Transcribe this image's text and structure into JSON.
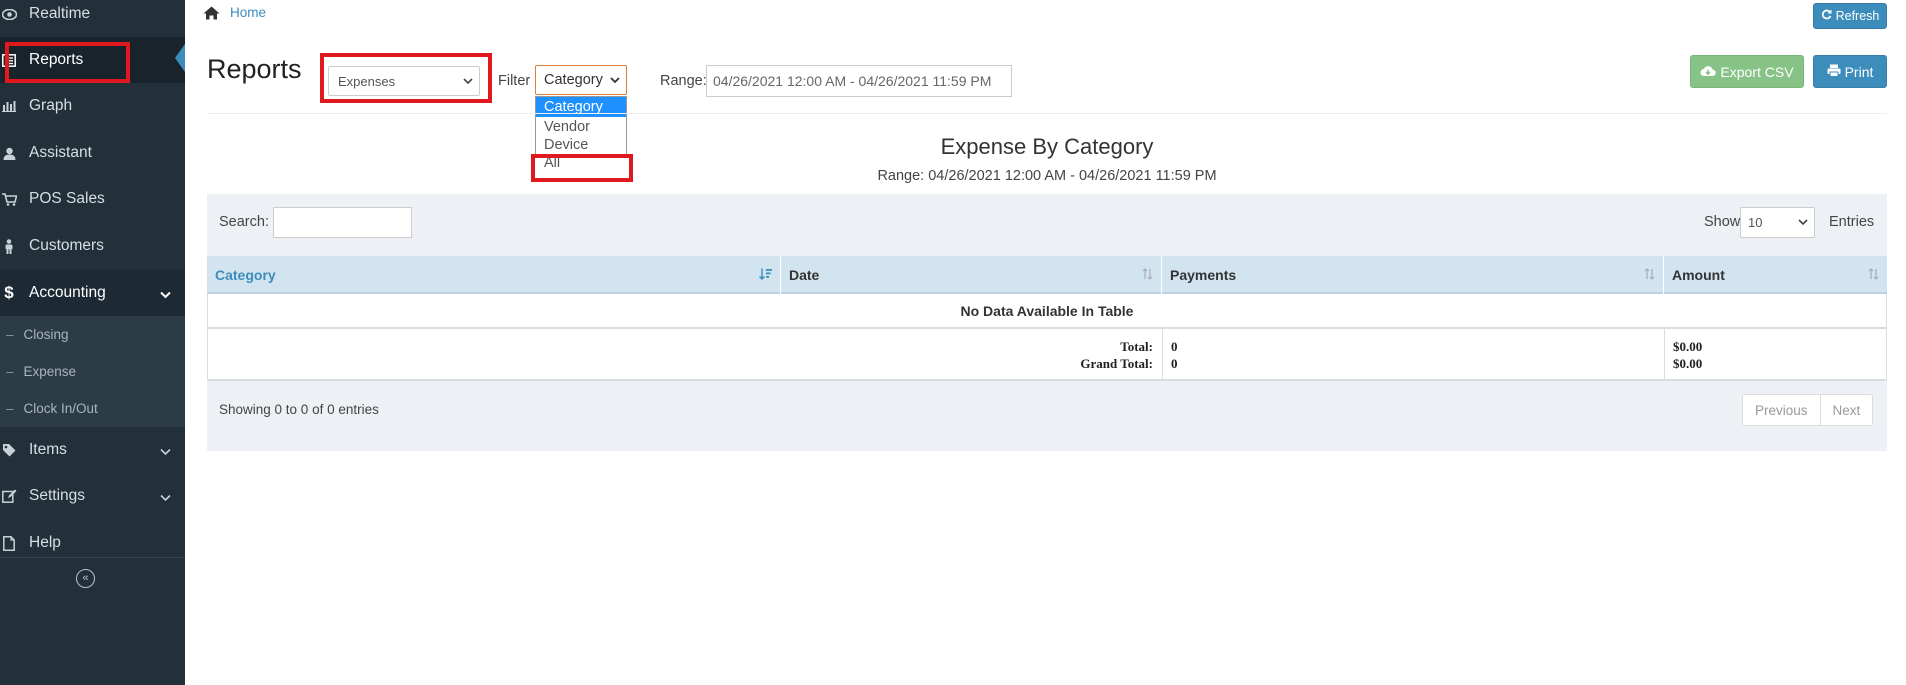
{
  "sidebar": {
    "items": [
      {
        "label": "Realtime",
        "icon": "eye-icon"
      },
      {
        "label": "Reports",
        "icon": "reports-icon"
      },
      {
        "label": "Graph",
        "icon": "bar-chart-icon"
      },
      {
        "label": "Assistant",
        "icon": "user-icon"
      },
      {
        "label": "POS Sales",
        "icon": "cart-icon"
      },
      {
        "label": "Customers",
        "icon": "person-icon"
      },
      {
        "label": "Accounting",
        "icon": "dollar-icon"
      },
      {
        "label": "Items",
        "icon": "tag-icon"
      },
      {
        "label": "Settings",
        "icon": "edit-icon"
      },
      {
        "label": "Help",
        "icon": "file-icon"
      }
    ],
    "accounting_sub": [
      {
        "label": "Closing"
      },
      {
        "label": "Expense"
      },
      {
        "label": "Clock In/Out"
      }
    ],
    "collapse_glyph": "«"
  },
  "breadcrumb": {
    "home": "Home"
  },
  "header": {
    "title": "Reports",
    "refresh_label": "Refresh",
    "export_label": "Export CSV",
    "print_label": "Print"
  },
  "controls": {
    "report_type": "Expenses",
    "filter_label": "Filter",
    "filter_value": "Category",
    "filter_options": [
      "Category",
      "Vendor",
      "Device",
      "All"
    ],
    "range_label": "Range:",
    "range_value": "04/26/2021 12:00 AM - 04/26/2021 11:59 PM"
  },
  "report": {
    "heading": "Expense By Category",
    "range_text": "Range: 04/26/2021 12:00 AM - 04/26/2021 11:59 PM"
  },
  "table": {
    "search_label": "Search:",
    "show_label": "Show",
    "entries_value": "10",
    "entries_label": "Entries",
    "columns": [
      "Category",
      "Date",
      "Payments",
      "Amount"
    ],
    "empty_text": "No Data Available In Table",
    "total_label": "Total:",
    "grand_total_label": "Grand Total:",
    "total_payments": "0",
    "grand_total_payments": "0",
    "total_amount": "$0.00",
    "grand_total_amount": "$0.00",
    "showing_text": "Showing 0 to 0 of 0 entries",
    "prev_label": "Previous",
    "next_label": "Next"
  },
  "colors": {
    "sidebar_bg": "#22303a",
    "accent": "#3c8dbc",
    "export_green": "#87c286",
    "highlight_red": "#e0191f"
  }
}
